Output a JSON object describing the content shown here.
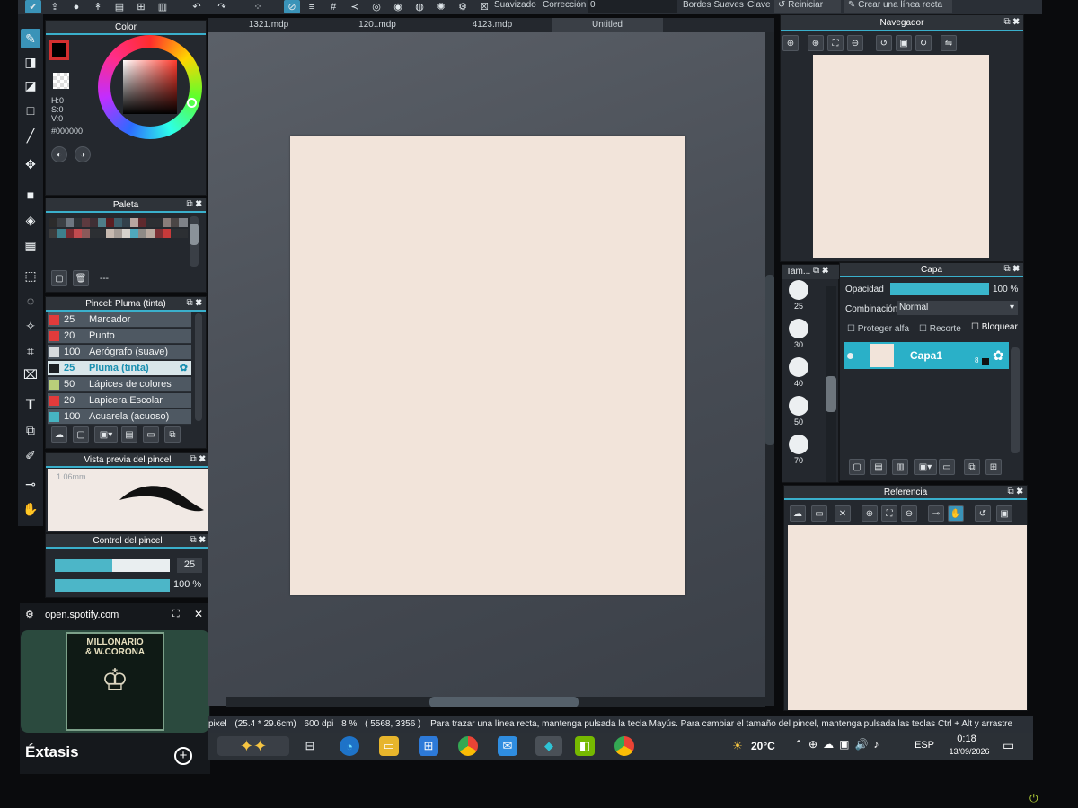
{
  "toolbar": {
    "suavizado_label": "Suavizado",
    "correccion_label": "Corrección",
    "correccion_value": "0",
    "bordes_label": "Bordes Suaves",
    "clave_label": "Clave",
    "reiniciar_label": "Reiniciar",
    "linea_recta_label": "Crear una línea recta"
  },
  "tabs": [
    "1321.mdp",
    "120..mdp",
    "4123.mdp",
    "Untitled"
  ],
  "color_panel": {
    "title": "Color",
    "h": "H:0",
    "s": "S:0",
    "v": "V:0",
    "hex": "#000000"
  },
  "palette_panel": {
    "title": "Paleta",
    "dash": "---",
    "swatches": [
      "#2b2b2b",
      "#3b3f44",
      "#6e7680",
      "#2f3438",
      "#5d3a3f",
      "#3f2f35",
      "#4f7d88",
      "#5a1e22",
      "#3d5d6a",
      "#33404a",
      "#b9a6a0",
      "#5f2a2e",
      "#2c2f33",
      "#2c2f33",
      "#8a7d7a",
      "#4b4646",
      "#7e8288",
      "#3c3c3c",
      "#3e7f8c",
      "#7a2b31",
      "#c14b4f",
      "#8a5a5a",
      "#2c2f33",
      "#2c2f33",
      "#c7b9b0",
      "#a59c96",
      "#d7d2cc",
      "#4fa9bd",
      "#8e8a86",
      "#b9aaa0",
      "#7b3034",
      "#c73a3a",
      "#2c2f33",
      "#2c2f33"
    ]
  },
  "brush_panel": {
    "title": "Pincel: Pluma (tinta)",
    "items": [
      {
        "size": "25",
        "name": "Marcador",
        "color": "#e23b3b"
      },
      {
        "size": "20",
        "name": "Punto",
        "color": "#e23b3b"
      },
      {
        "size": "100",
        "name": "Aerógrafo (suave)",
        "color": "#d6dadd"
      },
      {
        "size": "25",
        "name": "Pluma (tinta)",
        "color": "#1c1f23"
      },
      {
        "size": "50",
        "name": "Lápices de colores",
        "color": "#b9cf7a"
      },
      {
        "size": "20",
        "name": "Lapicera Escolar",
        "color": "#e23b3b"
      },
      {
        "size": "100",
        "name": "Acuarela (acuoso)",
        "color": "#46b4c2"
      }
    ]
  },
  "preview_panel": {
    "title": "Vista previa del pincel",
    "size_text": "1.06mm"
  },
  "brush_control": {
    "title": "Control del pincel",
    "size_value": "25",
    "opacity_value": "100 %",
    "size_fraction": 0.5,
    "opacity_fraction": 1.0
  },
  "spotify": {
    "site": "open.spotify.com",
    "album_line1": "MILLONARIO",
    "album_line2": "& W.CORONA",
    "track": "Éxtasis"
  },
  "navigator_panel": {
    "title": "Navegador"
  },
  "size_panel": {
    "title": "Tam...",
    "sizes": [
      "25",
      "30",
      "40",
      "50",
      "70"
    ]
  },
  "layer_panel": {
    "title": "Capa",
    "opacity_label": "Opacidad",
    "opacity_value": "100 %",
    "blend_label": "Combinación",
    "blend_value": "Normal",
    "protect_alpha": "Proteger alfa",
    "clip": "Recorte",
    "lock": "Bloquear",
    "layer_name": "Capa1",
    "layer_badge": "8"
  },
  "reference_panel": {
    "title": "Referencia"
  },
  "status": {
    "unit": "pixel",
    "dims": "(25.4 * 29.6cm)",
    "dpi": "600 dpi",
    "zoom": "8 %",
    "coords": "( 5568, 3356 )",
    "hint": "Para trazar una línea recta, mantenga pulsada la tecla Mayús. Para cambiar el tamaño del pincel, mantenga pulsada las teclas Ctrl + Alt y arrastre"
  },
  "taskbar": {
    "weather": "20°C",
    "lang": "ESP",
    "time": "0:18",
    "date": "13/09/2026"
  },
  "colors": {
    "accent": "#1a8fb0",
    "paper": "#f2e4da",
    "panel": "#24282e"
  }
}
